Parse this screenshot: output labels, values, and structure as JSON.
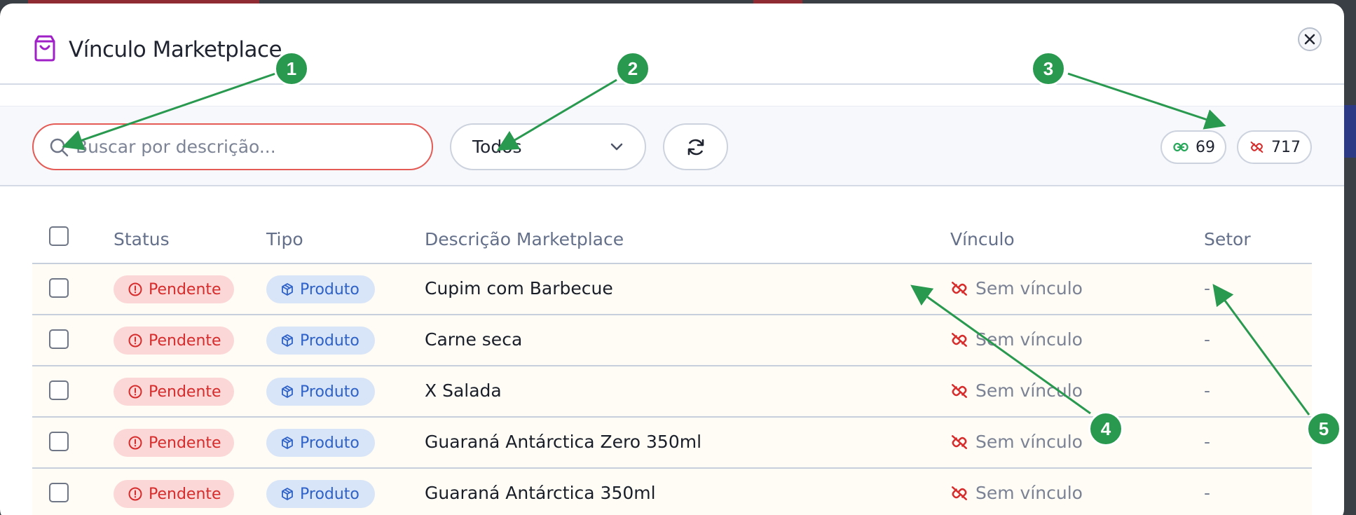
{
  "modal": {
    "title": "Vínculo Marketplace",
    "close_icon": "close-icon"
  },
  "toolbar": {
    "search_placeholder": "Buscar por descrição...",
    "filter_value": "Todos",
    "linked_count": "69",
    "unlinked_count": "717"
  },
  "table": {
    "headers": {
      "status": "Status",
      "tipo": "Tipo",
      "descricao": "Descrição Marketplace",
      "vinculo": "Vínculo",
      "setor": "Setor"
    },
    "rows": [
      {
        "status": "Pendente",
        "tipo": "Produto",
        "descricao": "Cupim com Barbecue",
        "vinculo": "Sem vínculo",
        "setor": "-"
      },
      {
        "status": "Pendente",
        "tipo": "Produto",
        "descricao": "Carne seca",
        "vinculo": "Sem vínculo",
        "setor": "-"
      },
      {
        "status": "Pendente",
        "tipo": "Produto",
        "descricao": "X Salada",
        "vinculo": "Sem vínculo",
        "setor": "-"
      },
      {
        "status": "Pendente",
        "tipo": "Produto",
        "descricao": "Guaraná Antárctica Zero 350ml",
        "vinculo": "Sem vínculo",
        "setor": "-"
      },
      {
        "status": "Pendente",
        "tipo": "Produto",
        "descricao": "Guaraná Antárctica 350ml",
        "vinculo": "Sem vínculo",
        "setor": "-"
      }
    ]
  },
  "annotations": [
    "1",
    "2",
    "3",
    "4",
    "5"
  ],
  "colors": {
    "accent_purple": "#a020c8",
    "error_red": "#e45b56",
    "link_green": "#29a85b",
    "marker_green": "#2a9950",
    "status_bg": "#fbd7d7",
    "tipo_bg": "#d8e4f7"
  }
}
